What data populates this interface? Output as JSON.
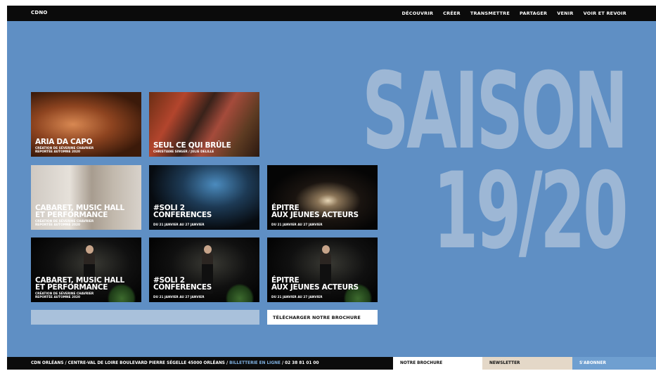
{
  "header": {
    "logo": "CDNO",
    "nav": [
      "DÉCOUVRIR",
      "CRÉER",
      "TRANSMETTRE",
      "PARTAGER",
      "VENIR",
      "VOIR ET REVOIR"
    ]
  },
  "hero": {
    "line1": "SAISON",
    "line2": "19/20"
  },
  "tiles": [
    {
      "title": "ARIA DA CAPO",
      "sub": "CRÉATION DE SÉVERINE CHAVRIER\nREPORTÉE AUTOMNE 2020"
    },
    {
      "title": "SEUL CE QUI BRÛLE",
      "sub": "CHRISTIANE SINGER / JULIE DELILLE"
    },
    {
      "title": "CABARET, MUSIC HALL\nET PERFORMANCE",
      "sub": "CRÉATION DE SÉVERINE CHAVRIER\nREPORTÉE AUTOMNE 2020"
    },
    {
      "title": "#SOLI 2\nCONFERENCES",
      "sub": "DU 21 JANVIER AU 27 JANVIER"
    },
    {
      "title": "ÉPITRE\nAUX JEUNES ACTEURS",
      "sub": "DU 21 JANVIER AU 27 JANVIER"
    },
    {
      "title": "CABARET, MUSIC HALL\nET PERFORMANCE",
      "sub": "CRÉATION DE SÉVERINE CHAVRIER\nREPORTÉE AUTOMNE 2020"
    },
    {
      "title": "#SOLI 2\nCONFERENCES",
      "sub": "DU 21 JANVIER AU 27 JANVIER"
    },
    {
      "title": "ÉPITRE\nAUX JEUNES ACTEURS",
      "sub": "DU 21 JANVIER AU 27 JANVIER"
    }
  ],
  "download_label": "TÉLÉCHARGER NOTRE BROCHURE",
  "footer": {
    "address": "CDN ORLÉANS / CENTRE-VAL DE LOIRE BOULEVARD PIERRE SÉGELLE 45000 ORLÉANS / ",
    "ticket_link": "BILLETTERIE EN LIGNE",
    "phone": " / 02 38 81 01 00",
    "brochure": "NOTRE BROCHURE",
    "newsletter": "NEWSLETTER",
    "subscribe": "S'ABONNER"
  }
}
